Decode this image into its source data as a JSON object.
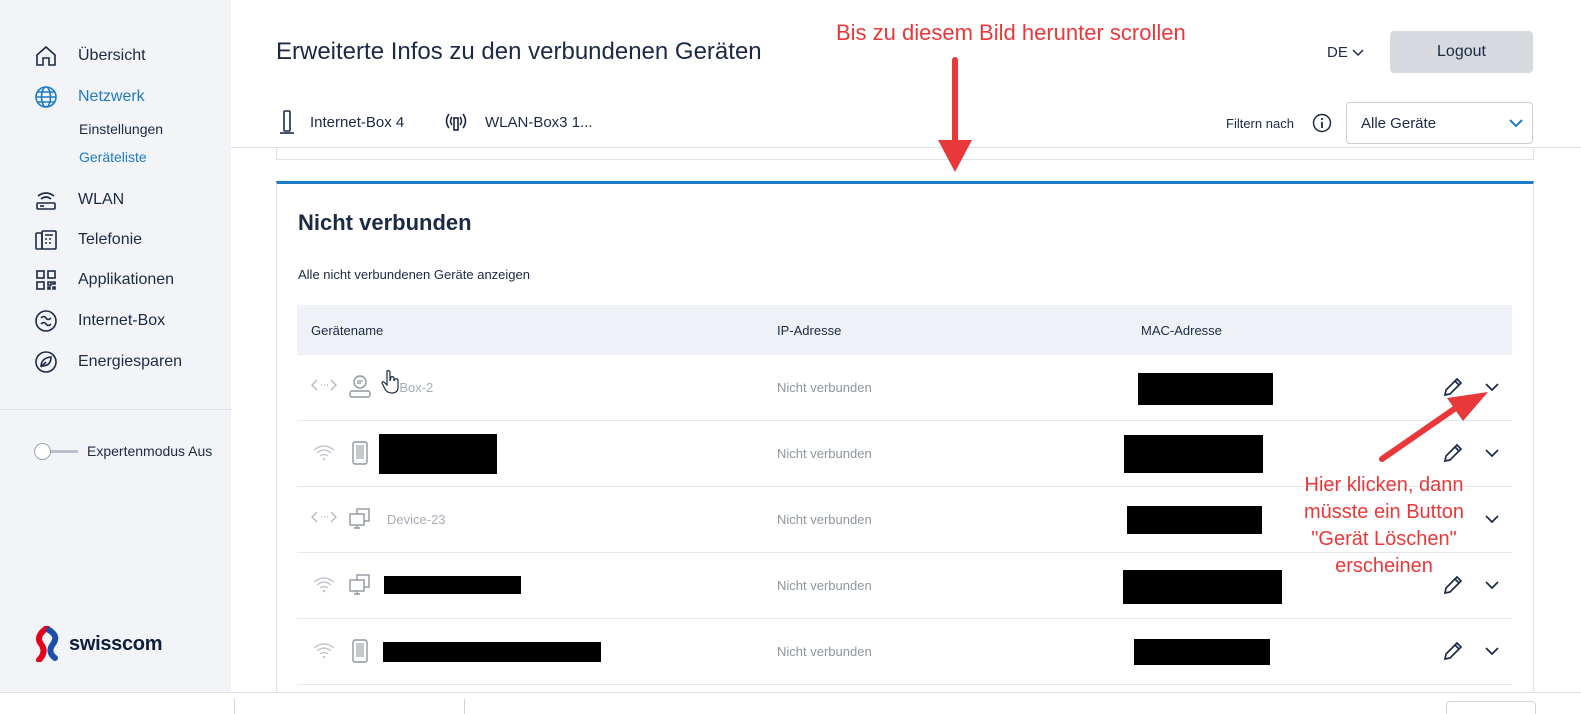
{
  "sidebar": {
    "items": [
      {
        "label": "Übersicht",
        "icon": "home-icon"
      },
      {
        "label": "Netzwerk",
        "icon": "globe-icon"
      },
      {
        "label": "WLAN",
        "icon": "router-icon"
      },
      {
        "label": "Telefonie",
        "icon": "fax-icon"
      },
      {
        "label": "Applikationen",
        "icon": "apps-icon"
      },
      {
        "label": "Internet-Box",
        "icon": "internet-box-icon"
      },
      {
        "label": "Energiesparen",
        "icon": "leaf-icon"
      }
    ],
    "subitems": [
      {
        "label": "Einstellungen"
      },
      {
        "label": "Geräteliste"
      }
    ],
    "expert_mode_label": "Expertenmodus Aus",
    "logo_text": "swisscom"
  },
  "header": {
    "title": "Erweiterte Infos zu den verbundenen Geräten",
    "lang": "DE",
    "logout_label": "Logout",
    "device_tabs": [
      {
        "label": "Internet-Box 4",
        "icon": "internet-box-device-icon"
      },
      {
        "label": "WLAN-Box3 1...",
        "icon": "wlan-box-icon"
      }
    ],
    "filter_label": "Filtern nach",
    "filter_value": "Alle Geräte"
  },
  "card": {
    "title": "Nicht verbunden",
    "subtitle": "Alle nicht verbundenen Geräte anzeigen",
    "columns": [
      "Gerätename",
      "IP-Adresse",
      "MAC-Adresse"
    ],
    "rows": [
      {
        "name": "-Box-2",
        "ip": "Nicht verbunden",
        "conn_icon": "ethernet-icon",
        "device_icon": "tv-box-icon"
      },
      {
        "name": "",
        "ip": "Nicht verbunden",
        "conn_icon": "wifi-icon",
        "device_icon": "phone-icon"
      },
      {
        "name": "Device-23",
        "ip": "Nicht verbunden",
        "conn_icon": "ethernet-icon",
        "device_icon": "computer-icon"
      },
      {
        "name": "",
        "ip": "Nicht verbunden",
        "conn_icon": "wifi-icon",
        "device_icon": "computer-icon"
      },
      {
        "name": "",
        "ip": "Nicht verbunden",
        "conn_icon": "wifi-icon",
        "device_icon": "phone-icon"
      }
    ]
  },
  "annotations": {
    "top": "Bis zu diesem Bild herunter scrollen",
    "right_lines": [
      "Hier klicken, dann",
      "müsste ein Button",
      "\"Gerät Löschen\"",
      "erscheinen"
    ]
  },
  "colors": {
    "accent": "#1e7bc6",
    "text": "#1b2a45",
    "sidebar_bg": "#f2f4f7",
    "annotation": "#e8383a"
  }
}
